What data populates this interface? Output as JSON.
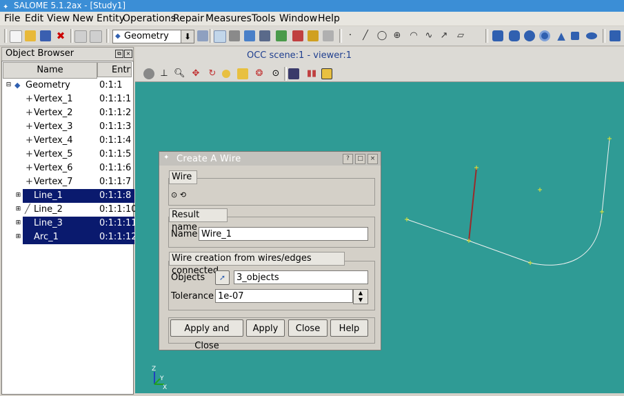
{
  "window": {
    "title": "SALOME 5.1.2ax - [Study1]"
  },
  "menu": [
    "File",
    "Edit",
    "View",
    "New Entity",
    "Operations",
    "Repair",
    "Measures",
    "Tools",
    "Window",
    "Help"
  ],
  "toolbar": {
    "module_combo": "Geometry"
  },
  "object_browser": {
    "title": "Object Browser",
    "col_name": "Name",
    "col_entry": "Entry",
    "rows": [
      {
        "name": "Geometry",
        "entry": "0:1:1"
      },
      {
        "name": "Vertex_1",
        "entry": "0:1:1:1"
      },
      {
        "name": "Vertex_2",
        "entry": "0:1:1:2"
      },
      {
        "name": "Vertex_3",
        "entry": "0:1:1:3"
      },
      {
        "name": "Vertex_4",
        "entry": "0:1:1:4"
      },
      {
        "name": "Vertex_5",
        "entry": "0:1:1:5"
      },
      {
        "name": "Vertex_6",
        "entry": "0:1:1:6"
      },
      {
        "name": "Vertex_7",
        "entry": "0:1:1:7"
      },
      {
        "name": "Line_1",
        "entry": "0:1:1:8"
      },
      {
        "name": "Line_2",
        "entry": "0:1:1:10"
      },
      {
        "name": "Line_3",
        "entry": "0:1:1:11"
      },
      {
        "name": "Arc_1",
        "entry": "0:1:1:12"
      }
    ]
  },
  "viewer": {
    "title": "OCC scene:1 - viewer:1",
    "axis_labels": [
      "Z",
      "Y",
      "X"
    ]
  },
  "dialog": {
    "title": "Create A Wire",
    "group_wire": "Wire",
    "group_result": "Result name",
    "name_label": "Name",
    "name_value": "Wire_1",
    "group_creation": "Wire creation from wires/edges connected",
    "objects_label": "Objects",
    "objects_value": "3_objects",
    "tolerance_label": "Tolerance",
    "tolerance_value": "1e-07",
    "btn_apply_close": "Apply and Close",
    "btn_apply": "Apply",
    "btn_close": "Close",
    "btn_help": "Help"
  },
  "colors": {
    "viewport": "#2f9b95",
    "selection": "#0a1a6e",
    "titlebar": "#3b8ed6"
  }
}
